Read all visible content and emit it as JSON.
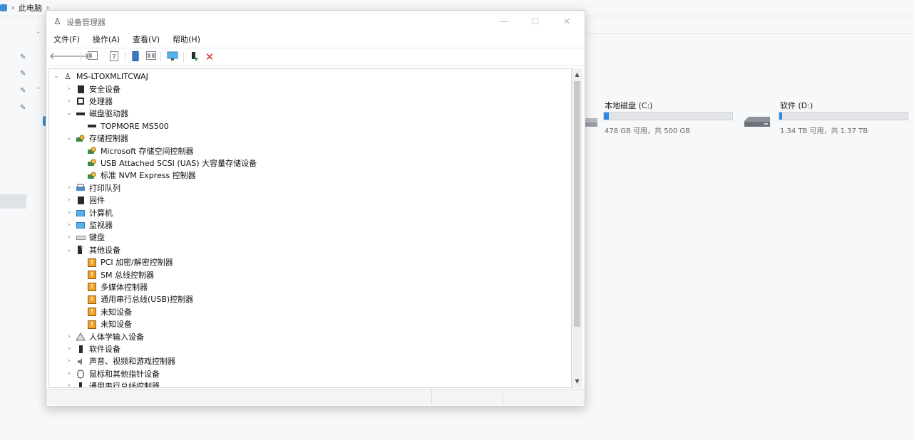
{
  "explorer": {
    "breadcrumb": "此电脑",
    "drives": [
      {
        "name": "本地磁盘 (C:)",
        "info": "478 GB 可用，共 500 GB",
        "used_fraction": 0.04
      },
      {
        "name": "软件 (D:)",
        "info": "1.34 TB 可用，共 1.37 TB",
        "used_fraction": 0.02
      }
    ]
  },
  "window": {
    "title": "设备管理器",
    "menu": [
      "文件(F)",
      "操作(A)",
      "查看(V)",
      "帮助(H)"
    ],
    "tree": {
      "root": "MS-LTOXMLITCWAJ",
      "items": [
        {
          "label": "安全设备",
          "icon": "security-device-icon",
          "expanded": false,
          "depth": 1
        },
        {
          "label": "处理器",
          "icon": "processor-icon",
          "expanded": false,
          "depth": 1
        },
        {
          "label": "磁盘驱动器",
          "icon": "disk-drive-icon",
          "expanded": true,
          "depth": 1
        },
        {
          "label": "TOPMORE MS500",
          "icon": "disk-drive-icon",
          "depth": 2
        },
        {
          "label": "存储控制器",
          "icon": "storage-controller-icon",
          "expanded": true,
          "depth": 1
        },
        {
          "label": "Microsoft 存储空间控制器",
          "icon": "storage-controller-icon",
          "depth": 2
        },
        {
          "label": "USB Attached SCSI (UAS) 大容量存储设备",
          "icon": "storage-controller-icon",
          "depth": 2
        },
        {
          "label": "标准 NVM Express 控制器",
          "icon": "storage-controller-icon",
          "depth": 2
        },
        {
          "label": "打印队列",
          "icon": "print-queue-icon",
          "expanded": false,
          "depth": 1
        },
        {
          "label": "固件",
          "icon": "firmware-icon",
          "expanded": false,
          "depth": 1
        },
        {
          "label": "计算机",
          "icon": "computer-icon",
          "expanded": false,
          "depth": 1
        },
        {
          "label": "监视器",
          "icon": "monitor-icon",
          "expanded": false,
          "depth": 1
        },
        {
          "label": "键盘",
          "icon": "keyboard-icon",
          "expanded": false,
          "depth": 1
        },
        {
          "label": "其他设备",
          "icon": "other-devices-icon",
          "expanded": true,
          "depth": 1
        },
        {
          "label": "PCI 加密/解密控制器",
          "icon": "warning-device-icon",
          "depth": 2
        },
        {
          "label": "SM 总线控制器",
          "icon": "warning-device-icon",
          "depth": 2
        },
        {
          "label": "多媒体控制器",
          "icon": "warning-device-icon",
          "depth": 2
        },
        {
          "label": "通用串行总线(USB)控制器",
          "icon": "warning-device-icon",
          "depth": 2
        },
        {
          "label": "未知设备",
          "icon": "warning-device-icon",
          "depth": 2
        },
        {
          "label": "未知设备",
          "icon": "warning-device-icon",
          "depth": 2
        },
        {
          "label": "人体学输入设备",
          "icon": "hid-icon",
          "expanded": false,
          "depth": 1
        },
        {
          "label": "软件设备",
          "icon": "software-device-icon",
          "expanded": false,
          "depth": 1
        },
        {
          "label": "声音、视频和游戏控制器",
          "icon": "sound-icon",
          "expanded": false,
          "depth": 1
        },
        {
          "label": "鼠标和其他指针设备",
          "icon": "mouse-icon",
          "expanded": false,
          "depth": 1
        },
        {
          "label": "通用串行总线控制器",
          "icon": "usb-icon",
          "expanded": false,
          "depth": 1
        }
      ]
    },
    "toolbar_icons": [
      "back-arrow-icon",
      "forward-arrow-icon",
      "properties-icon",
      "help-icon",
      "update-driver-icon",
      "show-hidden-icon",
      "scan-hardware-icon",
      "enable-device-icon",
      "uninstall-icon"
    ],
    "colors": {
      "accent": "#2f8ae0",
      "uninstall_red": "#d6262b",
      "warning": "#f0a22a"
    }
  }
}
